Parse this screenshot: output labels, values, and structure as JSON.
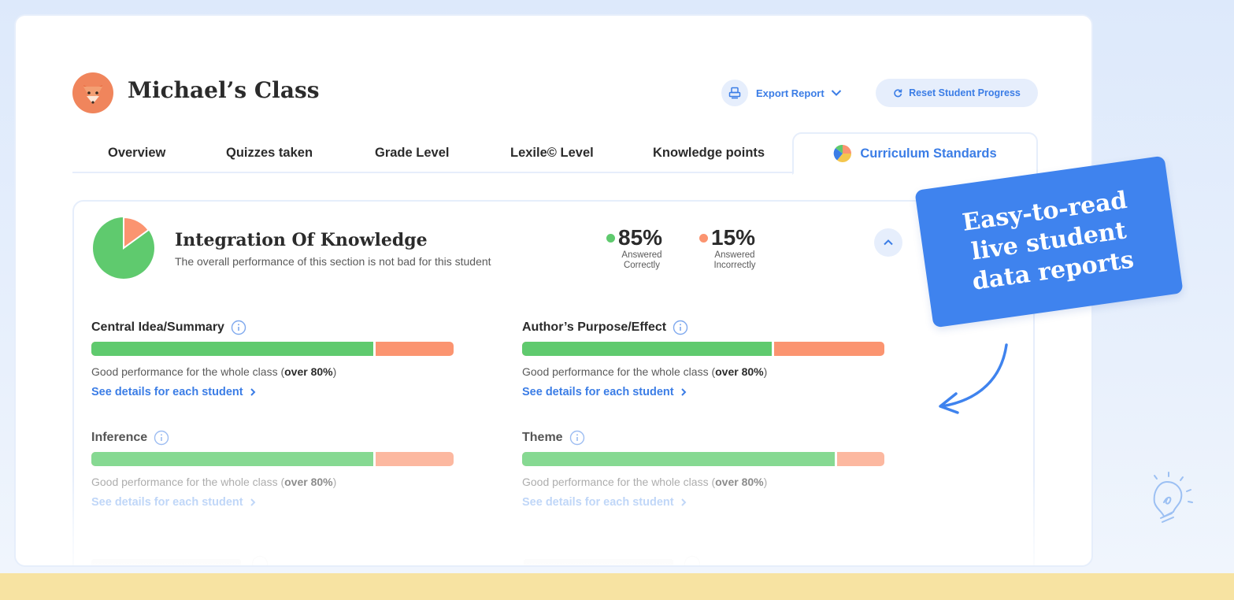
{
  "class": {
    "title": "Michael’s Class"
  },
  "toolbar": {
    "export_label": "Export Report",
    "reset_label": "Reset Student Progress"
  },
  "tabs": [
    {
      "label": "Overview"
    },
    {
      "label": "Quizzes taken"
    },
    {
      "label": "Grade Level"
    },
    {
      "label": "Lexile© Level"
    },
    {
      "label": "Knowledge points"
    },
    {
      "label": "Curriculum Standards",
      "active": true
    }
  ],
  "section": {
    "title": "Integration Of Knowledge",
    "subtitle": "The overall performance of this section is not bad for this student",
    "correct": {
      "value": "85%",
      "label": "Answered Correctly",
      "fraction": 0.85,
      "color": "#5fca6e"
    },
    "incorrect": {
      "value": "15%",
      "label": "Answered Incorrectly",
      "fraction": 0.15,
      "color": "#fb9470"
    }
  },
  "metrics": [
    {
      "name": "Central Idea/Summary",
      "fraction": 0.785,
      "note_prefix": "Good performance for the whole class (",
      "note_bold": "over 80%",
      "note_suffix": ")",
      "link": "See details for each student"
    },
    {
      "name": "Author’s Purpose/Effect",
      "fraction": 0.695,
      "note_prefix": "Good performance for the whole class (",
      "note_bold": "over 80%",
      "note_suffix": ")",
      "link": "See details for each student"
    },
    {
      "name": "Inference",
      "fraction": 0.785,
      "note_prefix": "Good performance for the whole class (",
      "note_bold": "over 80%",
      "note_suffix": ")",
      "link": "See details for each student"
    },
    {
      "name": "Theme",
      "fraction": 0.87,
      "note_prefix": "Good performance for the whole class (",
      "note_bold": "over 80%",
      "note_suffix": ")",
      "link": "See details for each student"
    }
  ],
  "callout": {
    "line1": "Easy-to-read",
    "line2": "live student",
    "line3": "data reports"
  }
}
